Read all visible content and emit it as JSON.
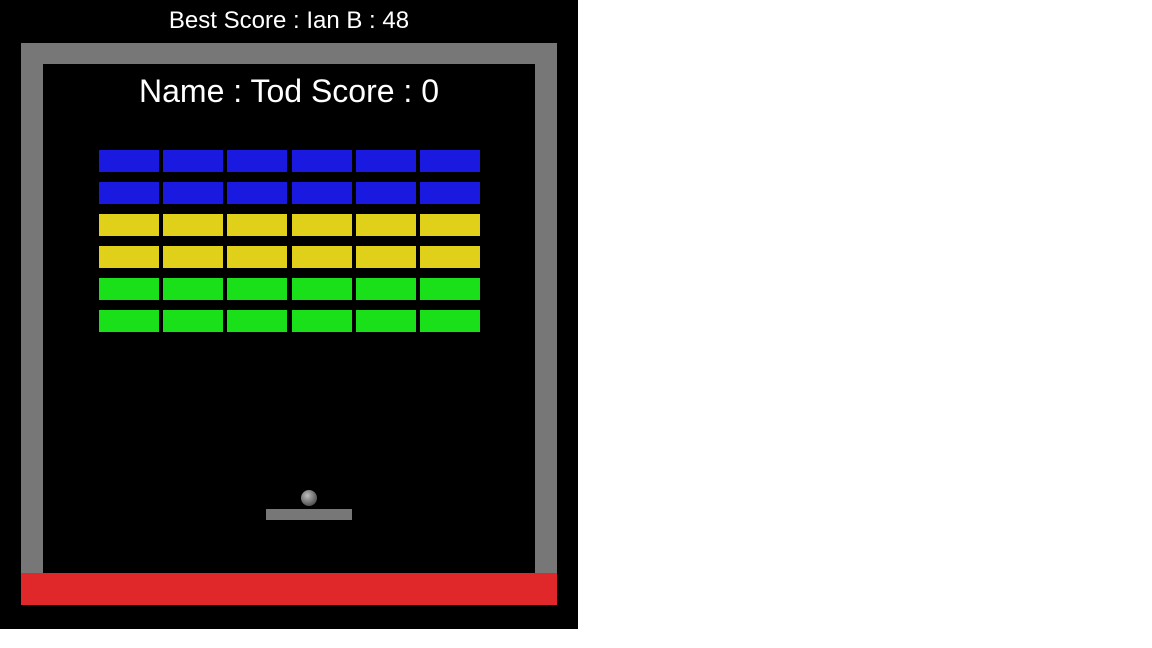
{
  "header": {
    "best_score_text": "Best Score : Ian B : 48"
  },
  "hud": {
    "player_score_text": "Name : Tod Score : 0"
  },
  "colors": {
    "background": "#000000",
    "wall": "#777777",
    "floor": "#e0272a",
    "paddle": "#777777",
    "ball": "#7a7a7a",
    "text": "#ffffff"
  },
  "bricks": {
    "columns": 6,
    "rows": [
      {
        "color": "#1919e0"
      },
      {
        "color": "#1919e0"
      },
      {
        "color": "#e0d019"
      },
      {
        "color": "#e0d019"
      },
      {
        "color": "#19e019"
      },
      {
        "color": "#19e019"
      }
    ]
  }
}
